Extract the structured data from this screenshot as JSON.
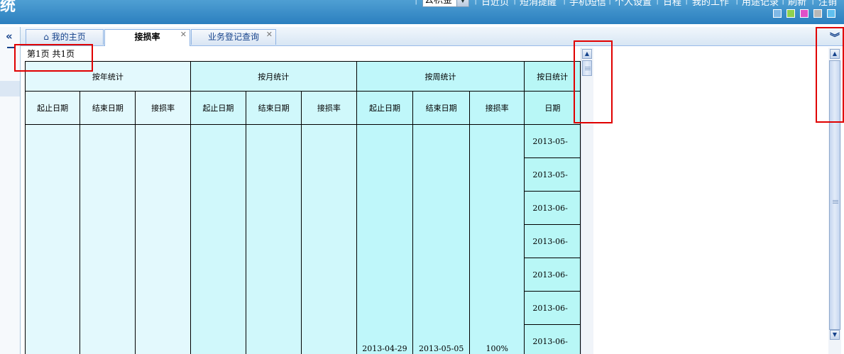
{
  "header": {
    "app_title_fragment": "统",
    "system_select_value": "公积金",
    "links": [
      "日近页",
      "短消提醒",
      "手机短信",
      "个人设置",
      "日程",
      "我的工作",
      "用途记录",
      "刷新",
      "注销"
    ],
    "skin_colors": [
      "#7fb8e6",
      "#8fd14f",
      "#e050c8",
      "#b8b8b8",
      "#5fbfef"
    ]
  },
  "tabs": [
    {
      "label": "我的主页",
      "icon": "home-icon"
    },
    {
      "label": "接损率",
      "active": true
    },
    {
      "label": "业务登记查询"
    }
  ],
  "pager": {
    "text": "第1页  共1页"
  },
  "grid": {
    "groups": [
      "按年统计",
      "按月统计",
      "按周统计",
      "按日统计"
    ],
    "columns": [
      "起止日期",
      "结束日期",
      "接损率",
      "起止日期",
      "结束日期",
      "接损率",
      "起止日期",
      "结束日期",
      "接损率",
      "日期"
    ],
    "week_row": {
      "start": "2013-04-29",
      "end": "2013-05-05",
      "rate": "100%"
    },
    "day_rows": [
      "2013-05-",
      "2013-05-",
      "2013-06-",
      "2013-06-",
      "2013-06-",
      "2013-06-",
      "2013-06-"
    ]
  },
  "colors": {
    "highlight": "#e00000",
    "header_blue": "#2b7fbf"
  }
}
